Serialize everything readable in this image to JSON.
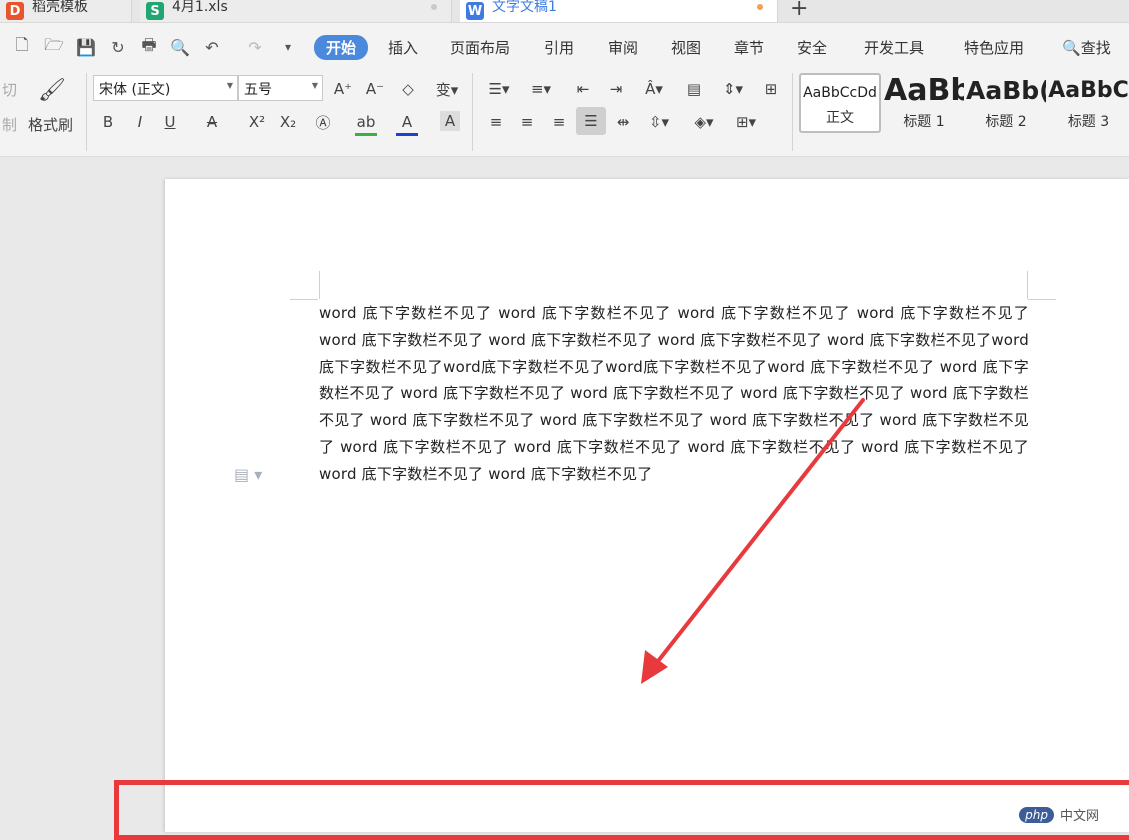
{
  "tabs": [
    {
      "label": "稻壳模板",
      "icon": "daoke-icon",
      "color": "#e8542d",
      "glyph": "D"
    },
    {
      "label": "4月1.xls",
      "icon": "spreadsheet-icon",
      "color": "#1fa672",
      "glyph": "S"
    },
    {
      "label": "文字文稿1",
      "icon": "writer-icon",
      "color": "#3d7be0",
      "glyph": "W"
    }
  ],
  "new_tab_label": "+",
  "menu": [
    "开始",
    "插入",
    "页面布局",
    "引用",
    "审阅",
    "视图",
    "章节",
    "安全",
    "开发工具",
    "特色应用"
  ],
  "search_label": "查找",
  "clipboard": {
    "cut": "切",
    "copy": "制",
    "format_painter": "格式刷"
  },
  "font": {
    "name": "宋体 (正文)",
    "size": "五号"
  },
  "format_buttons": {
    "bold": "B",
    "italic": "I",
    "underline": "U",
    "strike": "A",
    "super": "X²",
    "sub": "X₂",
    "font_color": "A",
    "highlight": "ab"
  },
  "styles": [
    {
      "preview": "AaBbCcDd",
      "label": "正文"
    },
    {
      "preview": "AaBb",
      "label": "标题 1"
    },
    {
      "preview": "AaBb(",
      "label": "标题 2"
    },
    {
      "preview": "AaBbC",
      "label": "标题 3"
    }
  ],
  "document": {
    "body": "word 底下字数栏不见了 word 底下字数栏不见了 word 底下字数栏不见了 word 底下字数栏不见了 word 底下字数栏不见了 word 底下字数栏不见了 word 底下字数栏不见了 word 底下字数栏不见了word 底下字数栏不见了word底下字数栏不见了word底下字数栏不见了word 底下字数栏不见了 word 底下字数栏不见了 word 底下字数栏不见了 word 底下字数栏不见了 word 底下字数栏不见了 word 底下字数栏不见了 word 底下字数栏不见了 word 底下字数栏不见了 word 底下字数栏不见了 word 底下字数栏不见了 word 底下字数栏不见了 word 底下字数栏不见了 word 底下字数栏不见了 word 底下字数栏不见了 word 底下字数栏不见了 word 底下字数栏不见了"
  },
  "annotation_color": "#e8393c",
  "watermark": {
    "badge": "php",
    "text": "中文网"
  }
}
